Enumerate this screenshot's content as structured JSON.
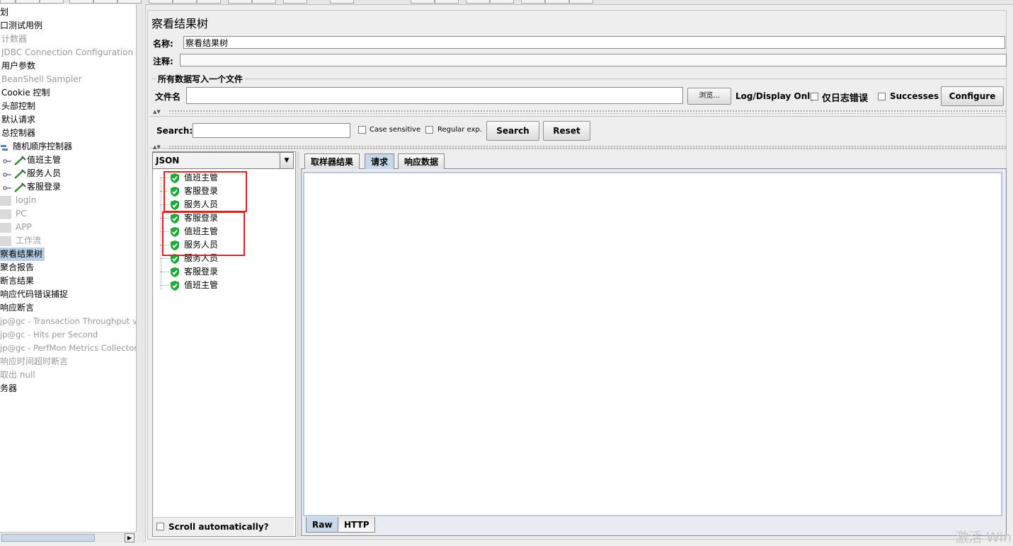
{
  "left_tree": {
    "items": [
      {
        "label": "划",
        "disabled": false
      },
      {
        "label": "口测试用例",
        "disabled": false
      },
      {
        "label": "计数器",
        "disabled": true
      },
      {
        "label": "JDBC Connection Configuration",
        "disabled": true
      },
      {
        "label": "用户参数",
        "disabled": false
      },
      {
        "label": "BeanShell Sampler",
        "disabled": true
      },
      {
        "label": "Cookie 控制",
        "disabled": false
      },
      {
        "label": "头部控制",
        "disabled": false
      },
      {
        "label": "默认请求",
        "disabled": false
      },
      {
        "label": "总控制器",
        "disabled": false
      },
      {
        "label": "随机顺序控制器",
        "disabled": false
      },
      {
        "label": "值班主管",
        "disabled": false
      },
      {
        "label": "服务人员",
        "disabled": false
      },
      {
        "label": "客服登录",
        "disabled": false
      },
      {
        "label": "login",
        "disabled": true
      },
      {
        "label": "PC",
        "disabled": true
      },
      {
        "label": "APP",
        "disabled": true
      },
      {
        "label": "工作流",
        "disabled": true
      },
      {
        "label": "察看结果树",
        "disabled": false
      },
      {
        "label": "聚合报告",
        "disabled": false
      },
      {
        "label": "断言结果",
        "disabled": false
      },
      {
        "label": "响应代码错误捕捉",
        "disabled": false
      },
      {
        "label": "响应断言",
        "disabled": false
      },
      {
        "label": "jp@gc - Transaction Throughput vs",
        "disabled": true
      },
      {
        "label": "jp@gc - Hits per Second",
        "disabled": true
      },
      {
        "label": "jp@gc - PerfMon Metrics Collector",
        "disabled": true
      },
      {
        "label": "响应时间超时断言",
        "disabled": true
      },
      {
        "label": "取出 null",
        "disabled": true
      },
      {
        "label": "务器",
        "disabled": false
      }
    ]
  },
  "panel": {
    "title": "察看结果树",
    "name_label": "名称:",
    "name_value": "察看结果树",
    "comment_label": "注释:",
    "comment_value": "",
    "file_section_title": "所有数据写入一个文件",
    "filename_label": "文件名",
    "filename_value": "",
    "browse_label": "浏览...",
    "log_display_label": "Log/Display Only:",
    "errors_only_label": "仅日志错误",
    "successes_label": "Successes",
    "configure_label": "Configure"
  },
  "search": {
    "label": "Search:",
    "value": "",
    "case_sensitive_label": "Case sensitive",
    "regex_label": "Regular exp.",
    "search_button": "Search",
    "reset_button": "Reset"
  },
  "results": {
    "renderer": "JSON",
    "samples": [
      {
        "label": "值班主管"
      },
      {
        "label": "客服登录"
      },
      {
        "label": "服务人员"
      },
      {
        "label": "客服登录"
      },
      {
        "label": "值班主管"
      },
      {
        "label": "服务人员"
      },
      {
        "label": "服务人员"
      },
      {
        "label": "客服登录"
      },
      {
        "label": "值班主管"
      }
    ],
    "scroll_auto_label": "Scroll automatically?"
  },
  "tabs": {
    "items": [
      {
        "label": "取样器结果"
      },
      {
        "label": "请求"
      },
      {
        "label": "响应数据"
      }
    ],
    "active": "请求",
    "bottom": [
      {
        "label": "Raw"
      },
      {
        "label": "HTTP"
      }
    ]
  },
  "watermark": "激活 Win",
  "colors": {
    "selection": "#b8cfe5",
    "annotation_red": "#e02020",
    "shield_green": "#1fa83c",
    "tab_active": "#c8d8ea"
  }
}
